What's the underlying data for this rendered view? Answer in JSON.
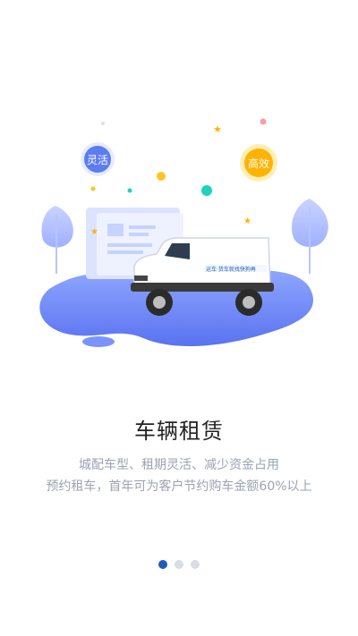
{
  "onboarding": {
    "title": "车辆租赁",
    "description_line1": "城配车型、租期灵活、减少资金占用",
    "description_line2": "预约租车，首年可为客户节约购车金额60%以上",
    "badges": {
      "flexible": "灵活",
      "efficient": "高效"
    },
    "van_text": "运车·货车就找快狗再",
    "pages": 3,
    "active_page": 1,
    "colors": {
      "accent": "#1e5db8",
      "badge_blue": "#5b7cf2",
      "badge_yellow": "#ffb300",
      "blob": "#6a87ff"
    }
  }
}
